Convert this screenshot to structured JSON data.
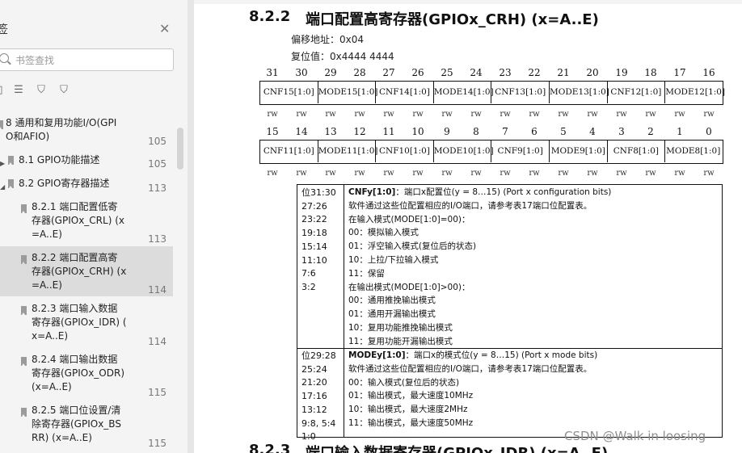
{
  "sidebar": {
    "title": "签",
    "search_placeholder": "书签查找",
    "items": [
      {
        "label": "8 通用和复用功能I/O(GPI O和AFIO)",
        "page": "105",
        "lines": [
          "8 通用和复用功能I/O(GPI",
          "O和AFIO)"
        ]
      },
      {
        "label": "8.1 GPIO功能描述",
        "page": "105",
        "lines": [
          "8.1 GPIO功能描述"
        ]
      },
      {
        "label": "8.2 GPIO寄存器描述",
        "page": "113",
        "lines": [
          "8.2 GPIO寄存器描述"
        ]
      },
      {
        "label": "8.2.1 端口配置低寄存器(GPIOx_CRL) (x=A..E)",
        "page": "113",
        "lines": [
          "8.2.1 端口配置低寄",
          "存器(GPIOx_CRL) (x",
          "=A..E)"
        ]
      },
      {
        "label": "8.2.2 端口配置高寄存器(GPIOx_CRH) (x=A..E)",
        "page": "114",
        "lines": [
          "8.2.2 端口配置高寄",
          "存器(GPIOx_CRH) (x",
          "=A..E)"
        ]
      },
      {
        "label": "8.2.3 端口输入数据寄存器(GPIOx_IDR) (x=A..E)",
        "page": "114",
        "lines": [
          "8.2.3 端口输入数据",
          "寄存器(GPIOx_IDR) (",
          "x=A..E)"
        ]
      },
      {
        "label": "8.2.4 端口输出数据寄存器(GPIOx_ODR) (x=A..E)",
        "page": "115",
        "lines": [
          "8.2.4 端口输出数据",
          "寄存器(GPIOx_ODR)",
          "(x=A..E)"
        ]
      },
      {
        "label": "8.2.5 端口位设置/清除寄存器(GPIOx_BSRR) (x=A..E)",
        "page": "115",
        "lines": [
          "8.2.5 端口位设置/清",
          "除寄存器(GPIOx_BS",
          "RR) (x=A..E)"
        ]
      }
    ]
  },
  "doc": {
    "section_num": "8.2.2",
    "section_title": "端口配置高寄存器(GPIOx_CRH) (x=A..E)",
    "offset": "偏移地址：0x04",
    "reset": "复位值：0x4444 4444",
    "upper_bits": [
      "31",
      "30",
      "29",
      "28",
      "27",
      "26",
      "25",
      "24",
      "23",
      "22",
      "21",
      "20",
      "19",
      "18",
      "17",
      "16"
    ],
    "lower_bits": [
      "15",
      "14",
      "13",
      "12",
      "11",
      "10",
      "9",
      "8",
      "7",
      "6",
      "5",
      "4",
      "3",
      "2",
      "1",
      "0"
    ],
    "upper_fields": [
      "CNF15[1:0]",
      "MODE15[1:0]",
      "CNF14[1:0]",
      "MODE14[1:0]",
      "CNF13[1:0]",
      "MODE13[1:0]",
      "CNF12[1:0]",
      "MODE12[1:0]"
    ],
    "lower_fields": [
      "CNF11[1:0]",
      "MODE11[1:0]",
      "CNF10[1:0]",
      "MODE10[1:0]",
      "CNF9[1:0]",
      "MODE9[1:0]",
      "CNF8[1:0]",
      "MODE8[1:0]"
    ],
    "access": "rw",
    "cnf_bits": "位31:30\n27:26\n23:22\n19:18\n15:14\n11:10\n7:6\n3:2",
    "cnf_name": "CNFy[1:0]",
    "cnf_lines": [
      "：端口x配置位(y = 8…15) (Port x configuration bits)",
      "软件通过这些位配置相应的I/O端口，请参考表17端口位配置表。",
      "在输入模式(MODE[1:0]=00)：",
      "00：模拟输入模式",
      "01：浮空输入模式(复位后的状态)",
      "10：上拉/下拉输入模式",
      "11：保留",
      "在输出模式(MODE[1:0]>00)：",
      "00：通用推挽输出模式",
      "01：通用开漏输出模式",
      "10：复用功能推挽输出模式",
      "11：复用功能开漏输出模式"
    ],
    "mode_bits": "位29:28\n25:24\n21:20\n17:16\n13:12\n9:8, 5:4\n1:0",
    "mode_name": "MODEy[1:0]",
    "mode_lines": [
      "：端口x的模式位(y = 8…15) (Port x mode bits)",
      "软件通过这些位配置相应的I/O端口，请参考表17端口位配置表。",
      "00：输入模式(复位后的状态)",
      "01：输出模式，最大速度10MHz",
      "10：输出模式，最大速度2MHz",
      "11：输出模式，最大速度50MHz"
    ],
    "next_section_num": "8.2.3",
    "next_section_title": "端口输入数据寄存器(GPIOx_IDR) (x=A..E)"
  },
  "watermark": "CSDN @Walk in loosing"
}
